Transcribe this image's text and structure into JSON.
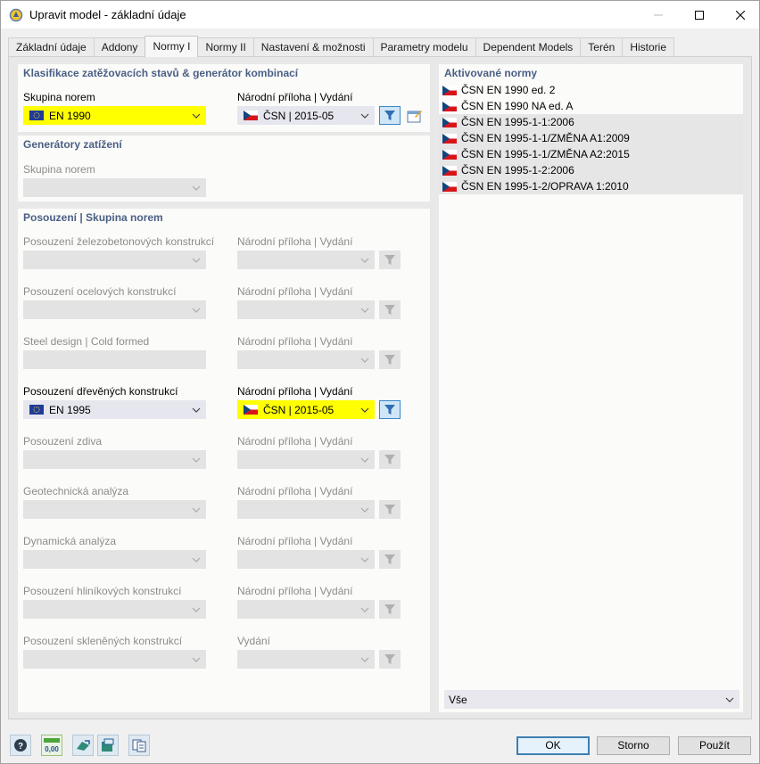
{
  "window": {
    "title": "Upravit model - základní údaje"
  },
  "tabs": [
    {
      "label": "Základní údaje"
    },
    {
      "label": "Addony"
    },
    {
      "label": "Normy I"
    },
    {
      "label": "Normy II"
    },
    {
      "label": "Nastavení & možnosti"
    },
    {
      "label": "Parametry modelu"
    },
    {
      "label": "Dependent Models"
    },
    {
      "label": "Terén"
    },
    {
      "label": "Historie"
    }
  ],
  "classification": {
    "title": "Klasifikace zatěžovacích stavů & generátor kombinací",
    "group_label": "Skupina norem",
    "group_value": "EN 1990",
    "annex_label": "Národní příloha | Vydání",
    "annex_value": "ČSN | 2015-05"
  },
  "generators": {
    "title": "Generátory zatížení",
    "group_label": "Skupina norem"
  },
  "design": {
    "title": "Posouzení | Skupina norem",
    "rows": [
      {
        "label": "Posouzení železobetonových konstrukcí",
        "annex_label": "Národní příloha | Vydání"
      },
      {
        "label": "Posouzení ocelových konstrukcí",
        "annex_label": "Národní příloha | Vydání"
      },
      {
        "label": "Steel design | Cold formed",
        "annex_label": "Národní příloha | Vydání"
      },
      {
        "label": "Posouzení dřevěných konstrukcí",
        "annex_label": "Národní příloha | Vydání",
        "value": "EN 1995",
        "annex_value": "ČSN | 2015-05"
      },
      {
        "label": "Posouzení zdiva",
        "annex_label": "Národní příloha | Vydání"
      },
      {
        "label": "Geotechnická analýza",
        "annex_label": "Národní příloha | Vydání"
      },
      {
        "label": "Dynamická analýza",
        "annex_label": "Národní příloha | Vydání"
      },
      {
        "label": "Posouzení hliníkových konstrukcí",
        "annex_label": "Národní příloha | Vydání"
      },
      {
        "label": "Posouzení skleněných konstrukcí",
        "annex_label": "Vydání"
      }
    ]
  },
  "activated": {
    "title": "Aktivované normy",
    "items": [
      {
        "label": "ČSN EN 1990 ed. 2"
      },
      {
        "label": "ČSN EN 1990 NA ed. A"
      },
      {
        "label": "ČSN EN 1995-1-1:2006"
      },
      {
        "label": "ČSN EN 1995-1-1/ZMĚNA A1:2009"
      },
      {
        "label": "ČSN EN 1995-1-1/ZMĚNA A2:2015"
      },
      {
        "label": "ČSN EN 1995-1-2:2006"
      },
      {
        "label": "ČSN EN 1995-1-2/OPRAVA 1:2010"
      }
    ],
    "filter_value": "Vše"
  },
  "bottom": {
    "decimals_icon_text": "0,00",
    "ok_label": "OK",
    "cancel_label": "Storno",
    "apply_label": "Použít"
  },
  "colors": {
    "highlight": "#ffff00",
    "section_title": "#4a5f85",
    "accent": "#3c7fb1"
  }
}
